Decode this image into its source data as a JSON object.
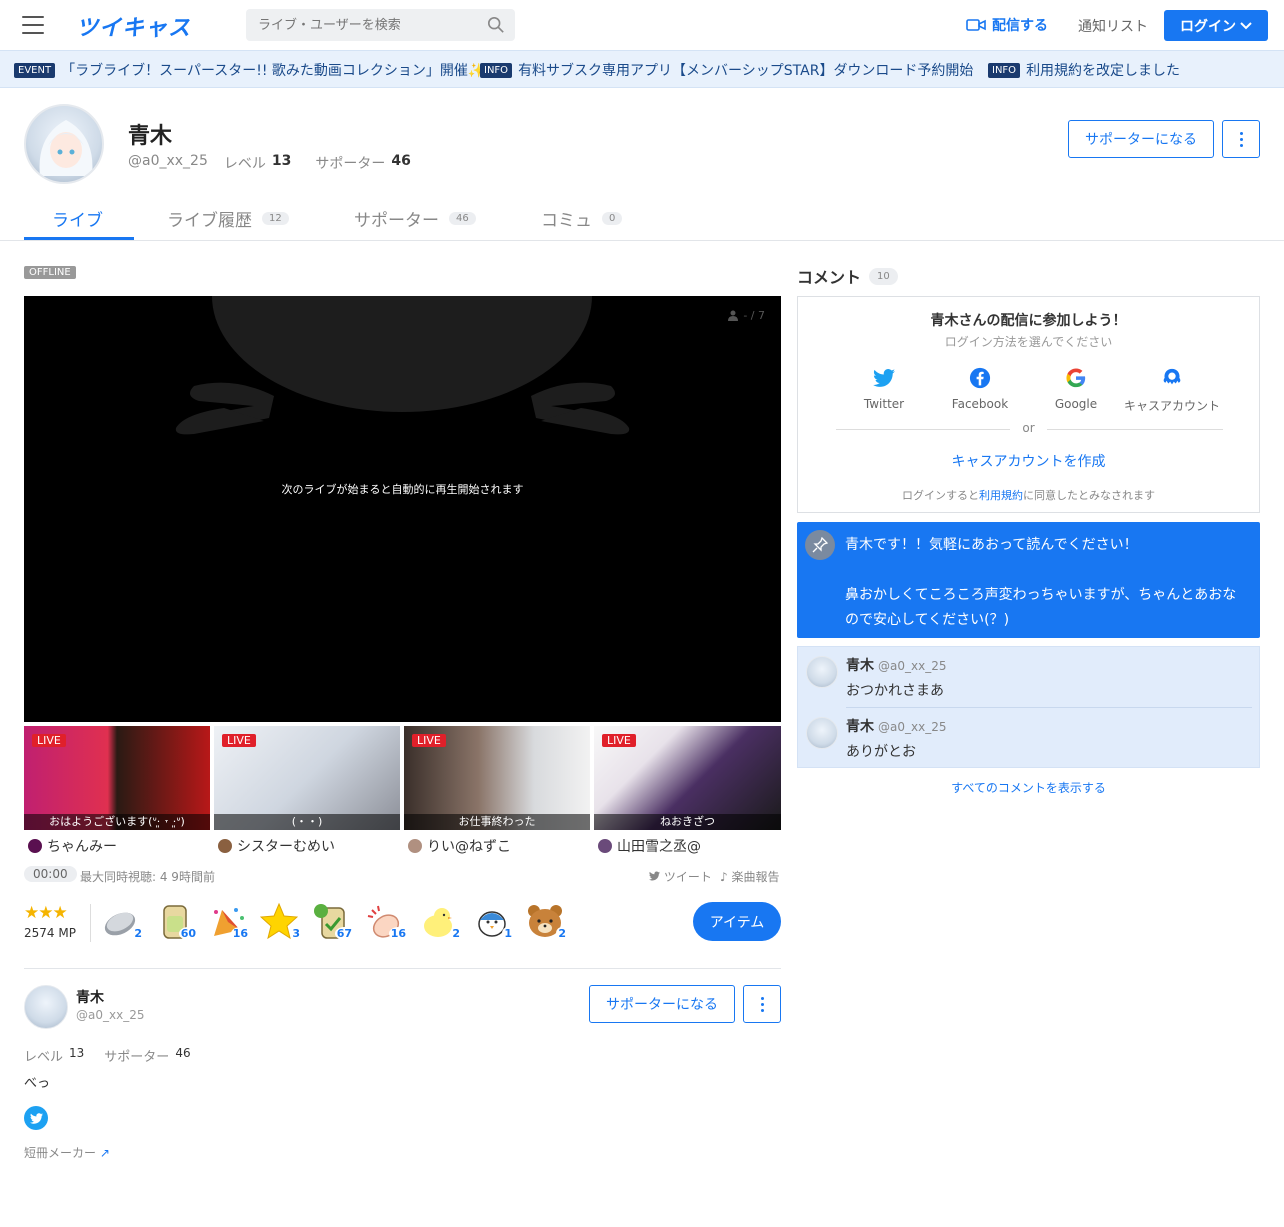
{
  "header": {
    "logo": "ツイキャス",
    "search_placeholder": "ライブ・ユーザーを検索",
    "broadcast_label": "配信する",
    "notify_label": "通知リスト",
    "login_label": "ログイン"
  },
  "ticker": [
    {
      "badge": "EVENT",
      "text": "「ラブライブ！スーパースター!! 歌みた動画コレクション」開催✨"
    },
    {
      "badge": "INFO",
      "text": "有料サブスク専用アプリ【メンバーシップSTAR】ダウンロード予約開始"
    },
    {
      "badge": "INFO",
      "text": "利用規約を改定しました"
    }
  ],
  "profile": {
    "name": "青木",
    "handle": "@a0_xx_25",
    "level_label": "レベル",
    "level": "13",
    "supporter_label": "サポーター",
    "supporters": "46",
    "support_button": "サポーターになる"
  },
  "tabs": [
    {
      "label": "ライブ",
      "count": ""
    },
    {
      "label": "ライブ履歴",
      "count": "12"
    },
    {
      "label": "サポーター",
      "count": "46"
    },
    {
      "label": "コミュ",
      "count": "0"
    }
  ],
  "player": {
    "status": "OFFLINE",
    "viewers": "- / 7",
    "message": "次のライブが始まると自動的に再生開始されます"
  },
  "related": [
    {
      "live": "LIVE",
      "caption": "おはようございます(ᐡ‧͈ ˕ ‧͈ᐡ)",
      "user": "ちゃんみー"
    },
    {
      "live": "LIVE",
      "caption": "(・・)",
      "user": "シスターむめい"
    },
    {
      "live": "LIVE",
      "caption": "お仕事終わった",
      "user": "りい@ねずこ"
    },
    {
      "live": "LIVE",
      "caption": "ねおきざつ",
      "user": "山田雪之丞@"
    }
  ],
  "stats": {
    "time": "00:00",
    "text": "最大同時視聴: 4  9時間前",
    "tweet": "ツイート",
    "song": "楽曲報告"
  },
  "items": {
    "stars": "★★★",
    "mp": "2574 MP",
    "gifts": [
      {
        "icon": "coin-icon",
        "count": "2"
      },
      {
        "icon": "tea-icon",
        "count": "60"
      },
      {
        "icon": "party-icon",
        "count": "16"
      },
      {
        "icon": "star-icon",
        "count": "3"
      },
      {
        "icon": "tea10-icon",
        "count": "67"
      },
      {
        "icon": "clap-icon",
        "count": "16"
      },
      {
        "icon": "chick-icon",
        "count": "2"
      },
      {
        "icon": "bird-icon",
        "count": "1"
      },
      {
        "icon": "bear-icon",
        "count": "2"
      }
    ],
    "button": "アイテム"
  },
  "bottom_profile": {
    "name": "青木",
    "handle": "@a0_xx_25",
    "level_label": "レベル",
    "level": "13",
    "supporter_label": "サポーター",
    "supporters": "46",
    "bio": "べっ",
    "tanzaku": "短冊メーカー",
    "support_button": "サポーターになる"
  },
  "comments": {
    "title": "コメント",
    "count": "10",
    "login_title": "青木さんの配信に参加しよう！",
    "login_sub": "ログイン方法を選んでください",
    "sns": [
      "Twitter",
      "Facebook",
      "Google",
      "キャスアカウント"
    ],
    "or": "or",
    "create": "キャスアカウントを作成",
    "terms_pre": "ログインすると",
    "terms_link": "利用規約",
    "terms_post": "に同意したとみなされます",
    "pinned": "青木です！！気軽にあおって読んでください！\n\n鼻おかしくてころころ声変わっちゃいますが、ちゃんとあおなので安心してください(？)",
    "list": [
      {
        "name": "青木",
        "handle": "@a0_xx_25",
        "text": "おつかれさまあ"
      },
      {
        "name": "青木",
        "handle": "@a0_xx_25",
        "text": "ありがとお"
      }
    ],
    "show_all": "すべてのコメントを表示する"
  },
  "colors": {
    "accent": "#1877f2",
    "live": "#e0202a"
  }
}
